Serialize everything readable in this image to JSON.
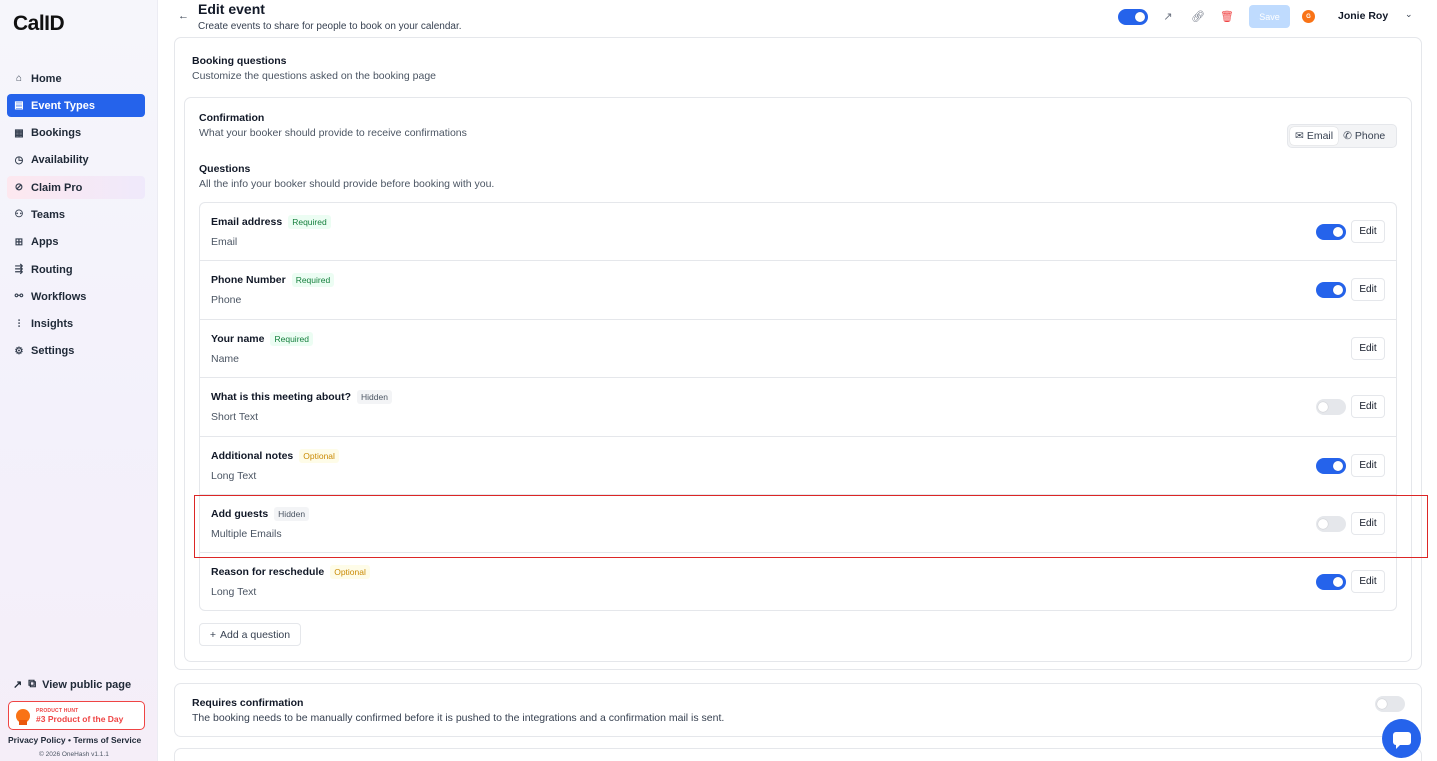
{
  "app": {
    "logo": "CalID"
  },
  "sidebar": {
    "items": [
      {
        "label": "Home",
        "icon": "⌂"
      },
      {
        "label": "Event Types",
        "icon": "▤"
      },
      {
        "label": "Bookings",
        "icon": "▦"
      },
      {
        "label": "Availability",
        "icon": "◷"
      },
      {
        "label": "Claim Pro",
        "icon": "⊘"
      },
      {
        "label": "Teams",
        "icon": "⚇"
      },
      {
        "label": "Apps",
        "icon": "⊞"
      },
      {
        "label": "Routing",
        "icon": "⇶"
      },
      {
        "label": "Workflows",
        "icon": "⚯"
      },
      {
        "label": "Insights",
        "icon": "⫶"
      },
      {
        "label": "Settings",
        "icon": "⚙"
      }
    ],
    "view_public": "View public page",
    "product_hunt_small": "PRODUCT HUNT",
    "product_hunt_big": "#3 Product of the Day",
    "legal": "Privacy Policy • Terms of Service",
    "copyright": "© 2026 OneHash v1.1.1"
  },
  "header": {
    "title": "Edit event",
    "subtitle": "Create events to share for people to book on your calendar.",
    "save_label": "Save",
    "avatar_initial": "G",
    "user_name": "Jonie Roy"
  },
  "booking_questions": {
    "title": "Booking questions",
    "subtitle": "Customize the questions asked on the booking page"
  },
  "confirmation": {
    "title": "Confirmation",
    "subtitle": "What your booker should provide to receive confirmations",
    "email_label": "Email",
    "phone_label": "Phone"
  },
  "questions": {
    "title": "Questions",
    "subtitle": "All the info your booker should provide before booking with you.",
    "edit_label": "Edit",
    "items": [
      {
        "label": "Email address",
        "badge": "Required",
        "type": "Email",
        "enabled": true
      },
      {
        "label": "Phone Number",
        "badge": "Required",
        "type": "Phone",
        "enabled": true
      },
      {
        "label": "Your name",
        "badge": "Required",
        "type": "Name",
        "enabled": null
      },
      {
        "label": "What is this meeting about?",
        "badge": "Hidden",
        "type": "Short Text",
        "enabled": false
      },
      {
        "label": "Additional notes",
        "badge": "Optional",
        "type": "Long Text",
        "enabled": true
      },
      {
        "label": "Add guests",
        "badge": "Hidden",
        "type": "Multiple Emails",
        "enabled": false
      },
      {
        "label": "Reason for reschedule",
        "badge": "Optional",
        "type": "Long Text",
        "enabled": true
      }
    ],
    "add_label": "Add a question"
  },
  "requires_confirmation": {
    "title": "Requires confirmation",
    "subtitle": "The booking needs to be manually confirmed before it is pushed to the integrations and a confirmation mail is sent."
  }
}
